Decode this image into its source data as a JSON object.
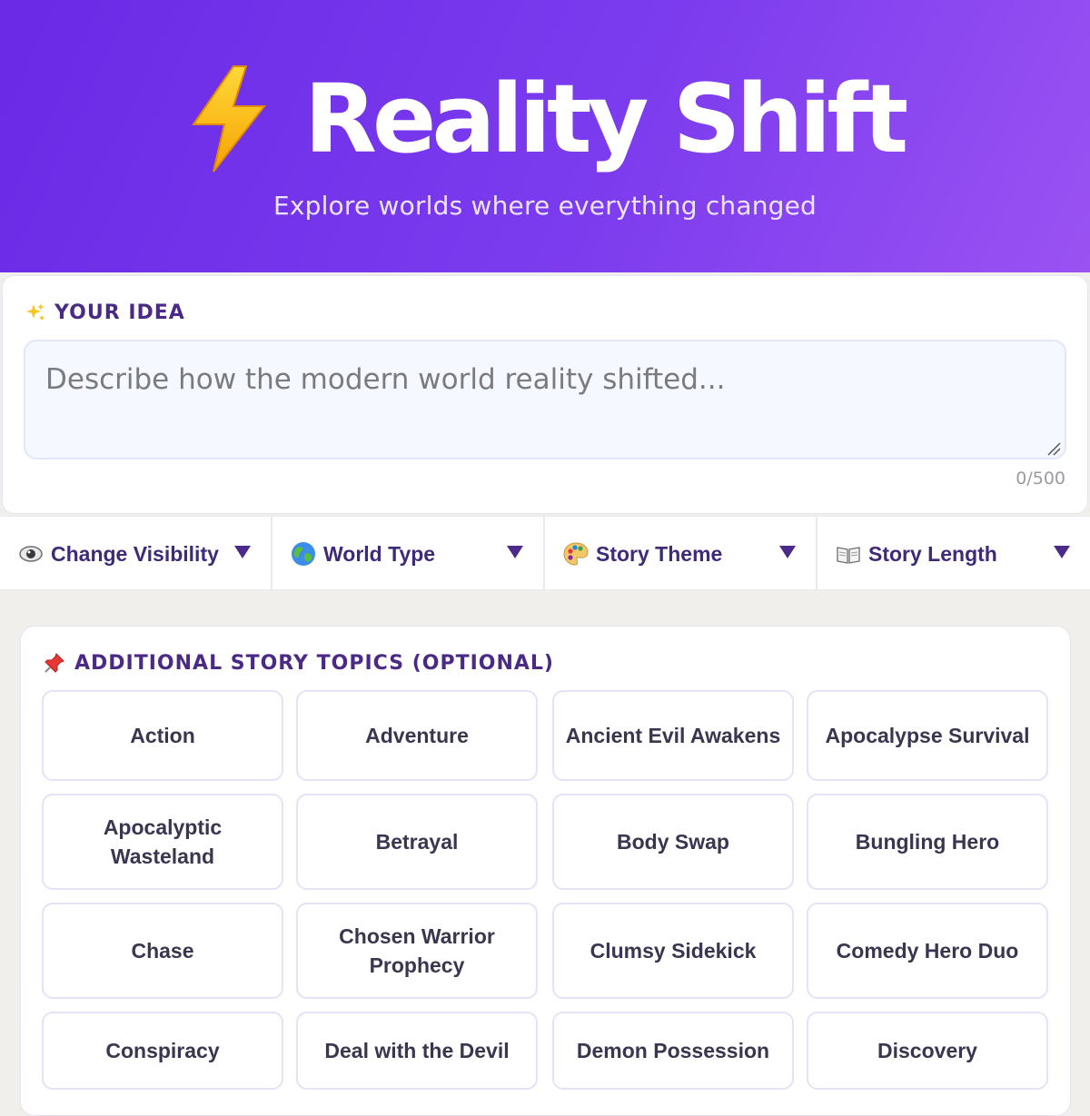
{
  "header": {
    "title": "Reality Shift",
    "subtitle": "Explore worlds where everything changed",
    "icon": "lightning-bolt-icon"
  },
  "idea": {
    "label": "YOUR IDEA",
    "icon": "sparkles-icon",
    "placeholder": "Describe how the modern world reality shifted...",
    "value": "",
    "char_count": "0/500"
  },
  "dropdowns": [
    {
      "label": "Change Visibility",
      "icon": "eye-icon"
    },
    {
      "label": "World Type",
      "icon": "globe-icon"
    },
    {
      "label": "Story Theme",
      "icon": "palette-icon"
    },
    {
      "label": "Story Length",
      "icon": "book-icon"
    }
  ],
  "topics": {
    "label": "ADDITIONAL STORY TOPICS (OPTIONAL)",
    "icon": "pushpin-icon",
    "items": [
      "Action",
      "Adventure",
      "Ancient Evil Awakens",
      "Apocalypse Survival",
      "Apocalyptic Wasteland",
      "Betrayal",
      "Body Swap",
      "Bungling Hero",
      "Chase",
      "Chosen Warrior Prophecy",
      "Clumsy Sidekick",
      "Comedy Hero Duo",
      "Conspiracy",
      "Deal with the Devil",
      "Demon Possession",
      "Discovery"
    ]
  },
  "colors": {
    "header_start": "#6a2ae6",
    "header_end": "#9a52f2",
    "accent_text": "#4b2a86"
  }
}
